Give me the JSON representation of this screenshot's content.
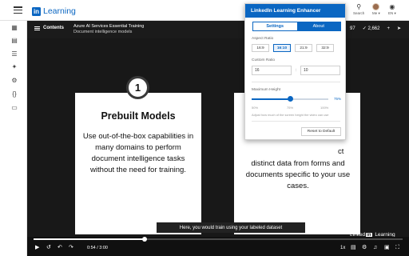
{
  "app": {
    "logo_badge": "in",
    "logo_word": "Learning",
    "search_label": "Search",
    "me_label": "Me ▾",
    "lang_label": "EN ▾"
  },
  "player": {
    "contents_label": "Contents",
    "course_title": "Azure AI Services Essential Training",
    "video_title": "Document intelligence models",
    "stat_fragment": "97",
    "likes_count": "2,662",
    "caption": "Here, you would train using your labeled dataset",
    "watermark_in": "Linked",
    "watermark_badge": "in",
    "watermark_word": "Learning",
    "time_current": "0:54",
    "time_total": "3:00",
    "time_display": "0:54 / 3:00",
    "speed": "1x",
    "progress_fraction": 0.3
  },
  "slide": {
    "step_number": "1",
    "left_title": "Prebuilt Models",
    "left_body": "Use out-of-the-box capabilities in many domains to perform document intelligence tasks without the need for training.",
    "right_stub": "ct",
    "right_body": "distinct data from forms and documents specific to your use cases."
  },
  "popup": {
    "title": "LinkedIn Learning Enhancer",
    "tabs": [
      "Settings",
      "About"
    ],
    "aspect_label": "Aspect Ratio",
    "ratios": [
      "16:9",
      "16:10",
      "21:9",
      "32:9"
    ],
    "selected_ratio": "16:10",
    "custom_label": "Custom Ratio",
    "custom_w": "16",
    "custom_sep": ":",
    "custom_h": "10",
    "max_height_label": "Maximum Height",
    "max_height_value": "75%",
    "max_height_fraction": 0.75,
    "ticks": [
      "50%",
      "75%",
      "100%"
    ],
    "hint": "Adjust how much of the screen height the video can use",
    "reset_label": "Reset to Default"
  },
  "colors": {
    "brand_blue": "#0a66c2",
    "player_bg": "#101010"
  }
}
